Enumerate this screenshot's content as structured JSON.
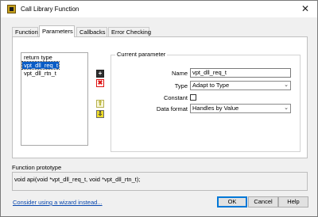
{
  "window": {
    "title": "Call Library Function"
  },
  "icons": {
    "app": "labview-app-icon",
    "close": "close-icon"
  },
  "tabs": [
    {
      "label": "Function"
    },
    {
      "label": "Parameters"
    },
    {
      "label": "Callbacks"
    },
    {
      "label": "Error Checking"
    }
  ],
  "active_tab": "Parameters",
  "parameters": {
    "list": [
      "return type",
      "vpt_dll_req_t",
      "vpt_dll_rtn_t"
    ],
    "selected": "vpt_dll_req_t",
    "tools": {
      "add": "+",
      "delete": "✖",
      "up": "⇧",
      "down": "⇩"
    }
  },
  "current_parameter": {
    "legend": "Current parameter",
    "name_label": "Name",
    "name_value": "vpt_dll_req_t",
    "type_label": "Type",
    "type_value": "Adapt to Type",
    "constant_label": "Constant",
    "constant_checked": false,
    "data_format_label": "Data format",
    "data_format_value": "Handles by Value"
  },
  "prototype": {
    "label": "Function prototype",
    "text": "void  api(void *vpt_dll_req_t, void *vpt_dll_rtn_t);"
  },
  "footer": {
    "wizard_link": "Consider using a wizard instead...",
    "ok": "OK",
    "cancel": "Cancel",
    "help": "Help"
  }
}
